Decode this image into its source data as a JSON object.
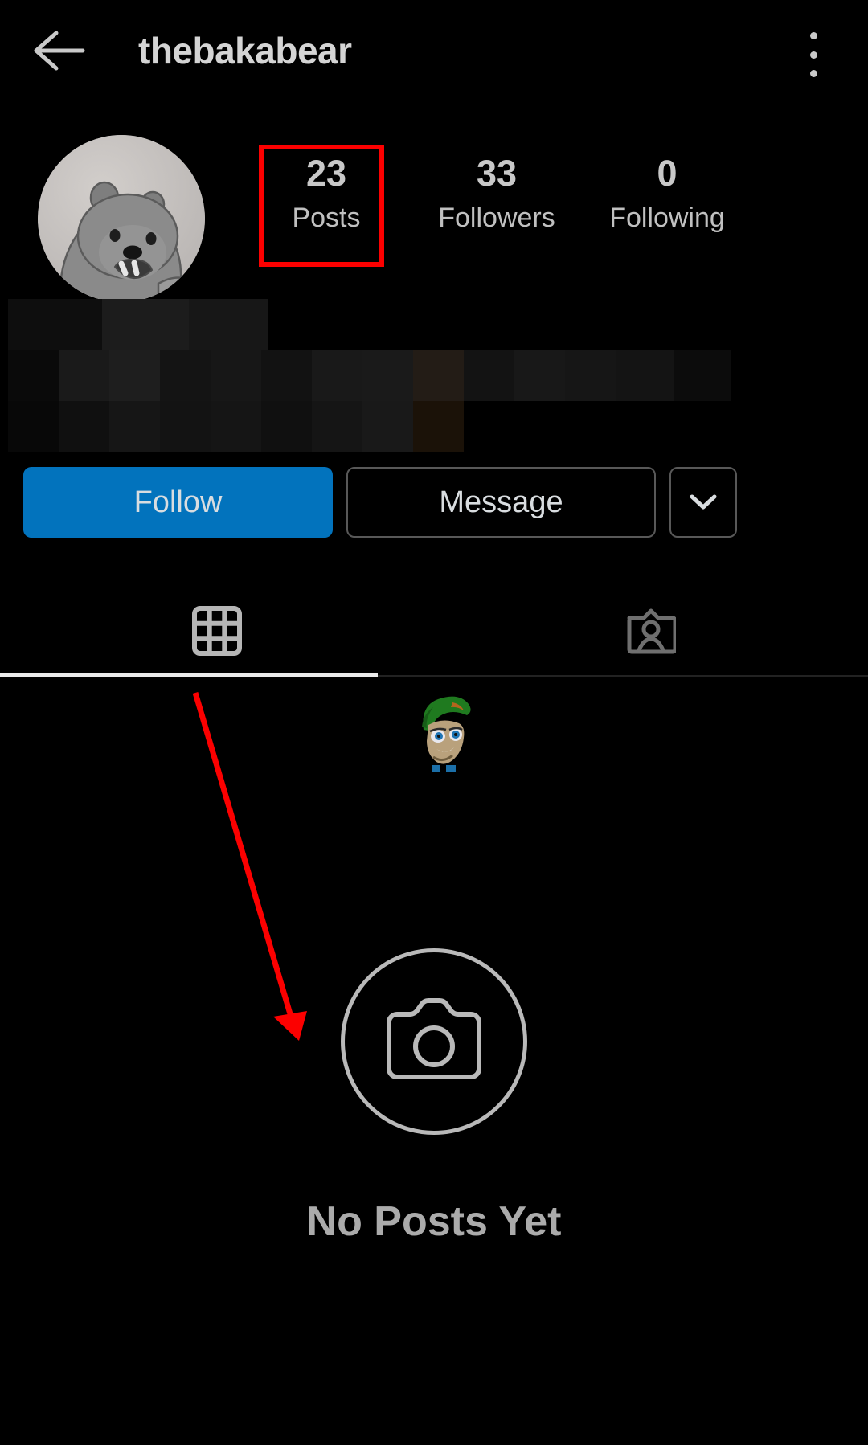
{
  "header": {
    "back_icon": "back-arrow-icon",
    "title": "thebakabear",
    "menu_icon": "kebab-menu-icon"
  },
  "profile": {
    "avatar_alt": "bear-avatar",
    "bio_censored": true,
    "stats": [
      {
        "value": "23",
        "label": "Posts",
        "highlighted": true
      },
      {
        "value": "33",
        "label": "Followers",
        "highlighted": false
      },
      {
        "value": "0",
        "label": "Following",
        "highlighted": false
      }
    ]
  },
  "actions": {
    "follow_label": "Follow",
    "message_label": "Message",
    "more_icon": "chevron-down-icon"
  },
  "tabs": [
    {
      "name": "grid",
      "icon": "grid-icon",
      "active": true
    },
    {
      "name": "tagged",
      "icon": "tagged-person-icon",
      "active": false
    }
  ],
  "empty_state": {
    "icon": "camera-icon",
    "title": "No Posts Yet"
  },
  "annotations": {
    "highlight_color": "#fc0000",
    "arrow_color": "#fc0000",
    "highlight_target": "Posts",
    "arrow_target": "No Posts Yet"
  },
  "colors": {
    "background": "#000000",
    "text_primary": "#d4d4d4",
    "text_secondary": "#c0c0c0",
    "follow_button": "#0273bd",
    "border": "#585858"
  }
}
